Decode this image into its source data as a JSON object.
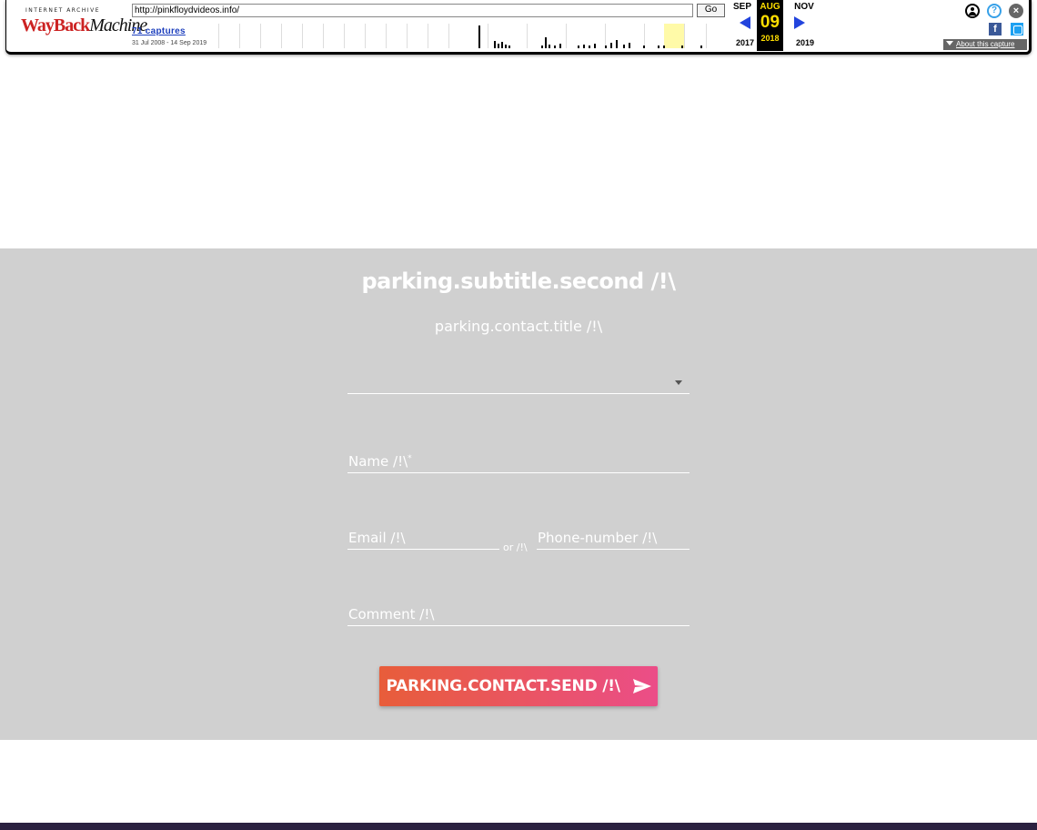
{
  "wayback": {
    "logo_top": "INTERNET ARCHIVE",
    "logo_way": "WayBack",
    "logo_machine": "Machine",
    "url": "http://pinkfloydvideos.info/",
    "go_label": "Go",
    "captures_label": "71 captures",
    "date_range": "31 Jul 2008 - 14 Sep 2019",
    "prev_month": "SEP",
    "current_month": "AUG",
    "next_month": "NOV",
    "current_day": "09",
    "prev_year": "2017",
    "current_year": "2018",
    "next_year": "2019",
    "help_glyph": "?",
    "close_glyph": "×",
    "fb_glyph": "f",
    "about_label": "About this capture",
    "highlight_color": "#fffaa8",
    "accent_color": "#ffde00"
  },
  "parking": {
    "subtitle": "parking.subtitle.second /!\\",
    "contact_title": "parking.contact.title /!\\",
    "dropdown_value": "",
    "name_label": "Name /!\\",
    "name_required": "*",
    "email_label": "Email /!\\",
    "or_label": "or /!\\",
    "phone_label": "Phone-number /!\\",
    "comment_label": "Comment /!\\",
    "send_label": "PARKING.CONTACT.SEND /!\\",
    "section_bg": "#d0d0d0",
    "button_gradient": [
      "#e85d3a",
      "#eb4d88"
    ]
  },
  "icons": {
    "user": "user-account-icon",
    "help": "help-icon",
    "close": "close-icon",
    "facebook": "facebook-icon",
    "twitter": "twitter-icon",
    "send": "paper-plane-icon"
  }
}
